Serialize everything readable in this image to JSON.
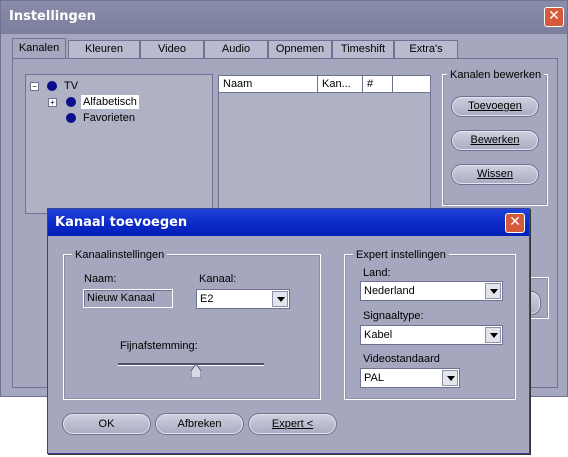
{
  "window": {
    "title": "Instellingen",
    "close_glyph": "✕",
    "tabs": [
      "Kanalen",
      "Kleuren",
      "Video",
      "Audio",
      "Opnemen",
      "Timeshift",
      "Extra's"
    ],
    "active_tab": "Kanalen",
    "tree": {
      "root": "TV",
      "children": [
        "Alfabetisch",
        "Favorieten"
      ],
      "selected": "Alfabetisch",
      "expand_glyph": "+",
      "collapse_glyph": "−"
    },
    "list_columns": [
      "Naam",
      "Kan...",
      "#"
    ],
    "edit_group": {
      "label": "Kanalen bewerken",
      "buttons": [
        "Toevoegen",
        "Bewerken",
        "Wissen"
      ]
    }
  },
  "dialog": {
    "title": "Kanaal toevoegen",
    "close_glyph": "✕",
    "channel_group": {
      "label": "Kanaalinstellingen",
      "name_label": "Naam:",
      "name_value": "Nieuw Kanaal",
      "channel_label": "Kanaal:",
      "channel_value": "E2",
      "finetune_label": "Fijnafstemming:",
      "finetune_level": 0.5
    },
    "expert_group": {
      "label": "Expert instellingen",
      "country_label": "Land:",
      "country_value": "Nederland",
      "signal_label": "Signaaltype:",
      "signal_value": "Kabel",
      "video_label": "Videostandaard",
      "video_value": "PAL"
    },
    "buttons": {
      "ok": "OK",
      "cancel": "Afbreken",
      "expert": "Expert <"
    }
  },
  "colors": {
    "face": "#a4a7bd",
    "dialog_title": "#0a28c6",
    "close": "#d55a3c",
    "node_dot": "#0c0c8c"
  }
}
